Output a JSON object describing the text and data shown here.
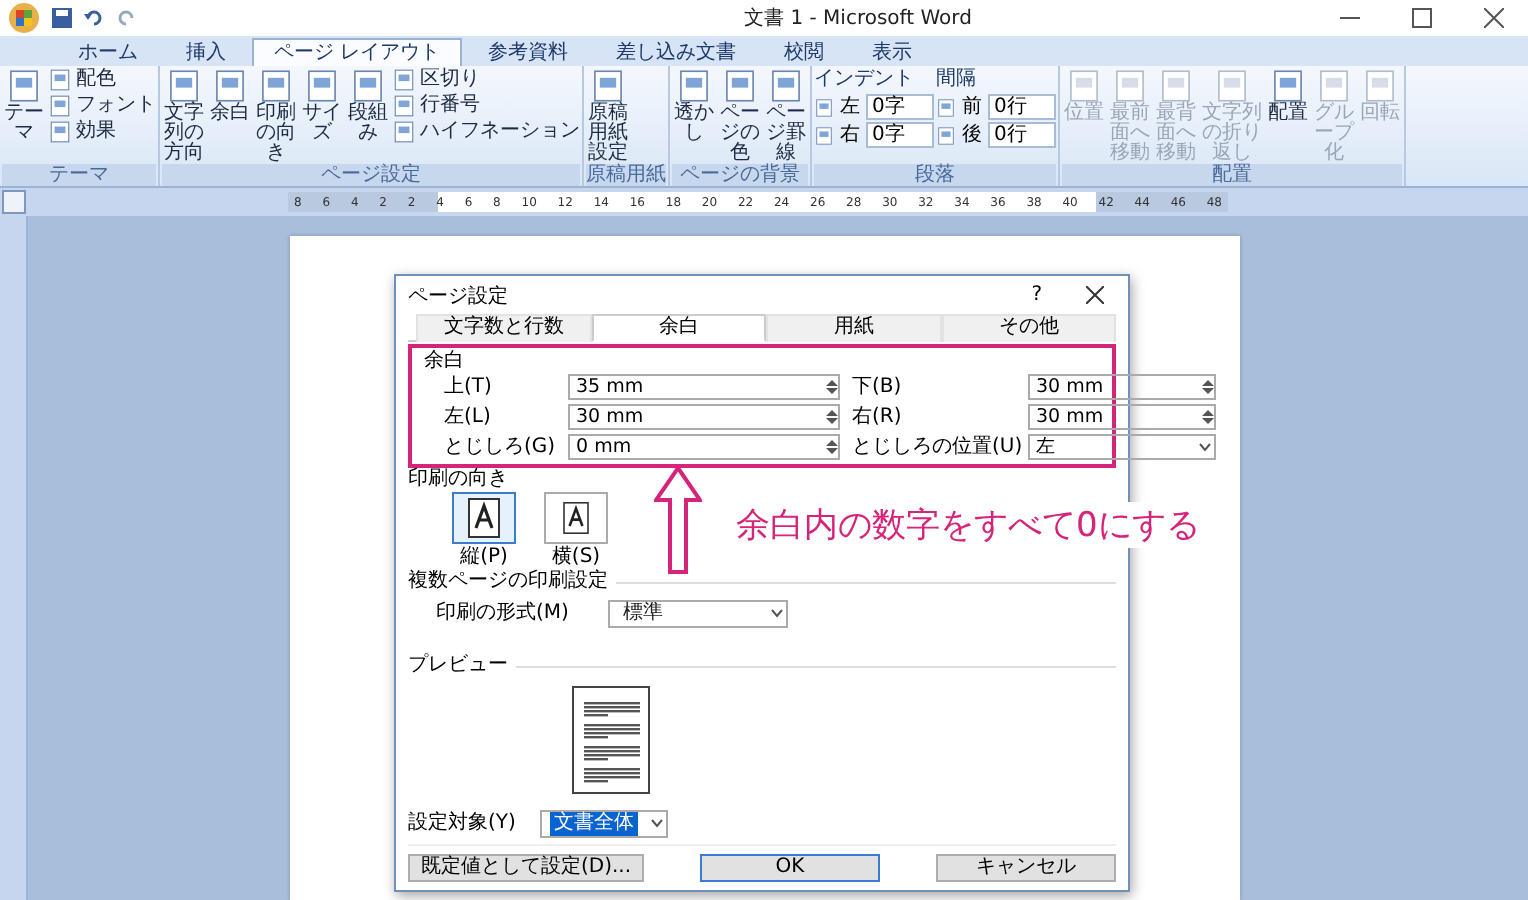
{
  "window": {
    "title": "文書 1 - Microsoft Word"
  },
  "tabs": [
    {
      "label": "ホーム",
      "selected": false
    },
    {
      "label": "挿入",
      "selected": false
    },
    {
      "label": "ページ レイアウト",
      "selected": true
    },
    {
      "label": "参考資料",
      "selected": false
    },
    {
      "label": "差し込み文書",
      "selected": false
    },
    {
      "label": "校閲",
      "selected": false
    },
    {
      "label": "表示",
      "selected": false
    }
  ],
  "ribbon": {
    "groups": [
      {
        "label": "テーマ",
        "columns": [
          {
            "kind": "large",
            "label": "テーマ",
            "disabled": false
          },
          {
            "kind": "stack",
            "items": [
              {
                "label": "配色",
                "disabled": false
              },
              {
                "label": "フォント",
                "disabled": false
              },
              {
                "label": "効果",
                "disabled": false
              }
            ]
          }
        ]
      },
      {
        "label": "ページ設定",
        "columns": [
          {
            "kind": "large",
            "label": "文字列の方向",
            "disabled": false
          },
          {
            "kind": "large",
            "label": "余白",
            "disabled": false
          },
          {
            "kind": "large",
            "label": "印刷の向き",
            "disabled": false
          },
          {
            "kind": "large",
            "label": "サイズ",
            "disabled": false
          },
          {
            "kind": "large",
            "label": "段組み",
            "disabled": false
          },
          {
            "kind": "stack",
            "items": [
              {
                "label": "区切り",
                "disabled": false
              },
              {
                "label": "行番号",
                "disabled": false
              },
              {
                "label": "ハイフネーション",
                "disabled": false
              }
            ]
          }
        ]
      },
      {
        "label": "原稿用紙",
        "columns": [
          {
            "kind": "large",
            "label": "原稿用紙設定",
            "disabled": false
          }
        ]
      },
      {
        "label": "ページの背景",
        "columns": [
          {
            "kind": "large",
            "label": "透かし",
            "disabled": false
          },
          {
            "kind": "large",
            "label": "ページの色",
            "disabled": false
          },
          {
            "kind": "large",
            "label": "ページ罫線",
            "disabled": false
          }
        ]
      },
      {
        "label": "段落",
        "columns": [
          {
            "kind": "spins",
            "heading": "インデント",
            "items": [
              {
                "label": "左",
                "value": "0字"
              },
              {
                "label": "右",
                "value": "0字"
              }
            ]
          },
          {
            "kind": "spins",
            "heading": "間隔",
            "items": [
              {
                "label": "前",
                "value": "0行"
              },
              {
                "label": "後",
                "value": "0行"
              }
            ]
          }
        ]
      },
      {
        "label": "配置",
        "columns": [
          {
            "kind": "large",
            "label": "位置",
            "disabled": true
          },
          {
            "kind": "large",
            "label": "最前面へ移動",
            "disabled": true
          },
          {
            "kind": "large",
            "label": "最背面へ移動",
            "disabled": true
          },
          {
            "kind": "large",
            "label": "文字列の折り返し",
            "disabled": true
          },
          {
            "kind": "large",
            "label": "配置",
            "disabled": false
          },
          {
            "kind": "large",
            "label": "グループ化",
            "disabled": true
          },
          {
            "kind": "large",
            "label": "回転",
            "disabled": true
          }
        ]
      }
    ]
  },
  "ruler": {
    "labels": [
      "8",
      "6",
      "4",
      "2",
      "2",
      "4",
      "6",
      "8",
      "10",
      "12",
      "14",
      "16",
      "18",
      "20",
      "22",
      "24",
      "26",
      "28",
      "30",
      "32",
      "34",
      "36",
      "38",
      "40",
      "42",
      "44",
      "46",
      "48"
    ]
  },
  "dialog": {
    "title": "ページ設定",
    "help": "?",
    "tabs": [
      {
        "label": "文字数と行数",
        "selected": false
      },
      {
        "label": "余白",
        "selected": true
      },
      {
        "label": "用紙",
        "selected": false
      },
      {
        "label": "その他",
        "selected": false
      }
    ],
    "margins": {
      "label": "余白",
      "fields": [
        {
          "label": "上(T)",
          "value": "35 mm",
          "kind": "spin"
        },
        {
          "label": "下(B)",
          "value": "30 mm",
          "kind": "spin"
        },
        {
          "label": "左(L)",
          "value": "30 mm",
          "kind": "spin"
        },
        {
          "label": "右(R)",
          "value": "30 mm",
          "kind": "spin"
        },
        {
          "label": "とじしろ(G)",
          "value": "0 mm",
          "kind": "spin"
        },
        {
          "label": "とじしろの位置(U)",
          "value": "左",
          "kind": "select"
        }
      ]
    },
    "orientation": {
      "label": "印刷の向き",
      "options": [
        {
          "label": "縦(P)",
          "selected": true
        },
        {
          "label": "横(S)",
          "selected": false
        }
      ]
    },
    "multi_page": {
      "label": "複数ページの印刷設定",
      "field_label": "印刷の形式(M)",
      "value": "標準"
    },
    "preview": {
      "label": "プレビュー"
    },
    "apply_to": {
      "label": "設定対象(Y)",
      "value": "文書全体"
    },
    "buttons": [
      {
        "label": "既定値として設定(D)...",
        "kind": "default"
      },
      {
        "label": "OK",
        "kind": "primary"
      },
      {
        "label": "キャンセル",
        "kind": "default"
      }
    ]
  },
  "annotation": {
    "text": "余白内の数字をすべて0にする"
  }
}
